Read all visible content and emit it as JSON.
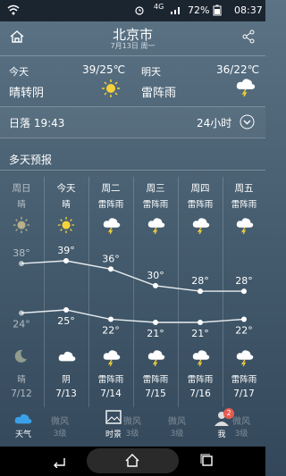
{
  "status": {
    "battery": "72%",
    "time": "08:37",
    "network": "4G"
  },
  "header": {
    "city": "北京市",
    "date": "7月13日 周一"
  },
  "today": {
    "label": "今天",
    "temp": "39/25℃",
    "desc": "晴转阴"
  },
  "tomorrow": {
    "label": "明天",
    "temp": "36/22℃",
    "desc": "雷阵雨"
  },
  "sunset": "日落 19:43",
  "hours24": "24小时",
  "forecast_title": "多天预报",
  "days": [
    {
      "name": "周日",
      "day_desc": "晴",
      "high": "38°",
      "low": "24°",
      "night_desc": "晴",
      "date": "7/12"
    },
    {
      "name": "今天",
      "day_desc": "晴",
      "high": "39°",
      "low": "25°",
      "night_desc": "阴",
      "date": "7/13"
    },
    {
      "name": "周二",
      "day_desc": "雷阵雨",
      "high": "36°",
      "low": "22°",
      "night_desc": "雷阵雨",
      "date": "7/14"
    },
    {
      "name": "周三",
      "day_desc": "雷阵雨",
      "high": "30°",
      "low": "21°",
      "night_desc": "雷阵雨",
      "date": "7/15"
    },
    {
      "name": "周四",
      "day_desc": "雷阵雨",
      "high": "28°",
      "low": "21°",
      "night_desc": "雷阵雨",
      "date": "7/16"
    },
    {
      "name": "周五",
      "day_desc": "雷阵雨",
      "high": "28°",
      "low": "22°",
      "night_desc": "雷阵雨",
      "date": "7/17"
    }
  ],
  "chart_data": {
    "type": "line",
    "categories": [
      "周日",
      "今天",
      "周二",
      "周三",
      "周四",
      "周五"
    ],
    "series": [
      {
        "values": [
          38,
          39,
          36,
          30,
          28,
          28
        ]
      },
      {
        "values": [
          24,
          25,
          22,
          21,
          21,
          22
        ]
      }
    ]
  },
  "bottom_nav": [
    {
      "label": "天气",
      "sub": ""
    },
    {
      "label": "微风",
      "sub": "3级"
    },
    {
      "label": "时景",
      "sub": "3级"
    },
    {
      "label": "微风",
      "sub": "3级"
    },
    {
      "label": "微风",
      "sub": "3级"
    },
    {
      "label": "我",
      "sub": ""
    },
    {
      "label": "微风",
      "sub": "3级"
    }
  ],
  "badge": "2"
}
